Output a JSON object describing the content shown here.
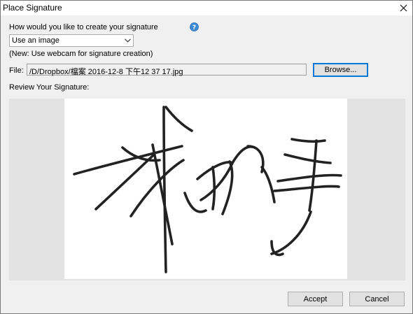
{
  "window": {
    "title": "Place Signature",
    "close_icon": "close-icon"
  },
  "form": {
    "question": "How would you like to create your signature",
    "help_icon": "help-icon",
    "method": {
      "selected": "Use an image",
      "options": [
        "Use an image"
      ]
    },
    "webcam_note": "(New: Use webcam for signature creation)",
    "file": {
      "label": "File:",
      "value": "/D/Dropbox/檔案 2016-12-8 下午12 37 17.jpg"
    },
    "browse_label": "Browse...",
    "review_label": "Review Your Signature:"
  },
  "preview": {
    "image": "handwritten-signature",
    "background": "#e3e3e3",
    "canvas": "#ffffff"
  },
  "actions": {
    "accept": "Accept",
    "cancel": "Cancel"
  },
  "colors": {
    "accent": "#0078d7",
    "dialog_bg": "#f0f0f0",
    "help_icon": "#3c8ad8"
  }
}
